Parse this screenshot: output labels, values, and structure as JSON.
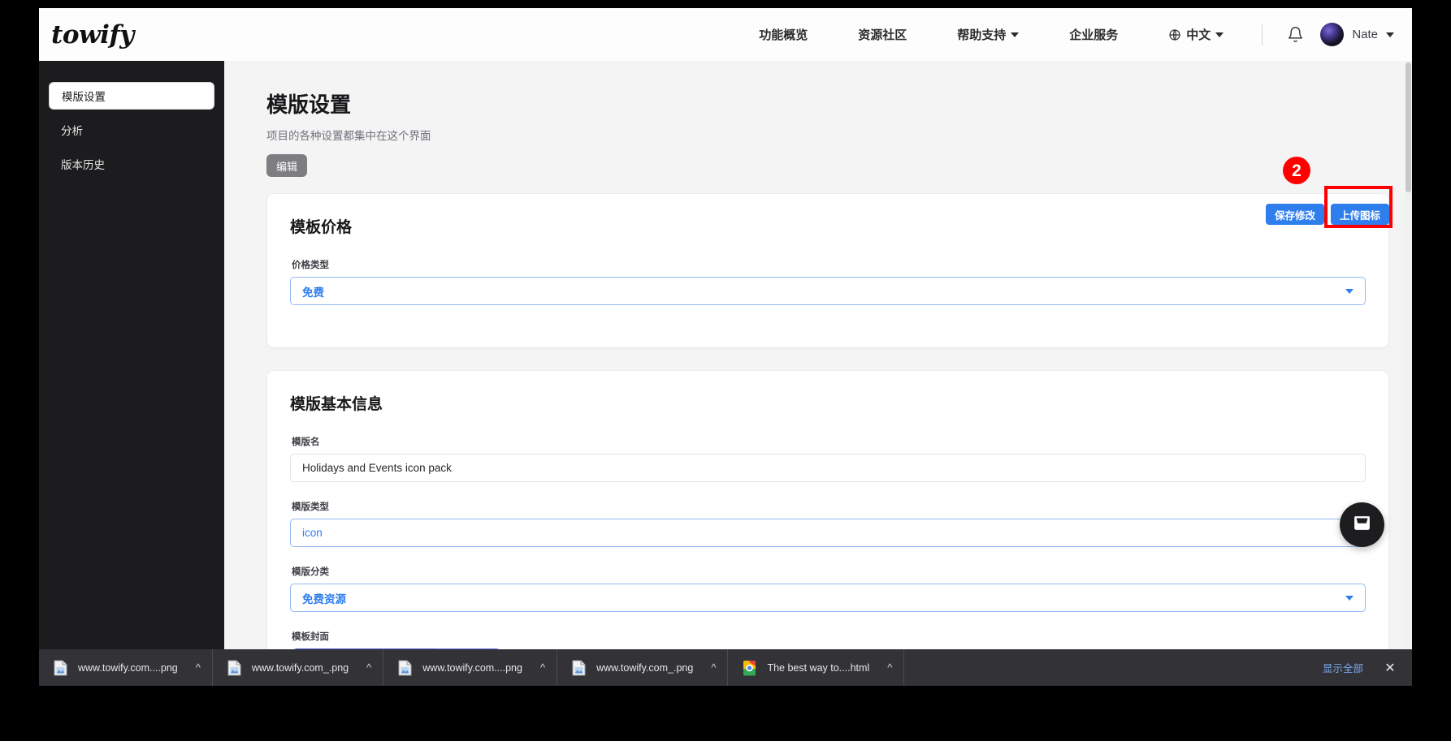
{
  "topnav": {
    "brand": "towify",
    "links": [
      {
        "label": "功能概览",
        "has_caret": false
      },
      {
        "label": "资源社区",
        "has_caret": false
      },
      {
        "label": "帮助支持",
        "has_caret": true
      },
      {
        "label": "企业服务",
        "has_caret": false
      },
      {
        "label": "中文",
        "has_caret": true,
        "icon": "globe-icon"
      }
    ],
    "bell_icon": "bell-icon",
    "avatar_icon": "avatar",
    "user_name": "Nate",
    "user_caret_icon": "chevron-down-icon"
  },
  "sidebar": {
    "items": [
      {
        "label": "模版设置",
        "active": true
      },
      {
        "label": "分析",
        "active": false
      },
      {
        "label": "版本历史",
        "active": false
      }
    ]
  },
  "page": {
    "title": "模版设置",
    "subtitle": "项目的各种设置都集中在这个界面",
    "edit_button": "编辑"
  },
  "actions": {
    "save_label": "保存修改",
    "upload_label": "上传图标"
  },
  "annotation": {
    "badge_number": "2",
    "highlight_color": "#ff0000",
    "target": "上传图标"
  },
  "price_card": {
    "title": "模板价格",
    "price_type_label": "价格类型",
    "price_type_value": "免费",
    "caret_icon": "chevron-down-icon"
  },
  "basic_card": {
    "title": "模版基本信息",
    "name_label": "模版名",
    "name_value": "Holidays and Events icon pack",
    "type_label": "模版类型",
    "type_value": "icon",
    "category_label": "模版分类",
    "category_value": "免费资源",
    "cover_label": "模板封面"
  },
  "chat": {
    "icon": "inbox-chat-icon"
  },
  "downloads": {
    "items": [
      {
        "name": "www.towify.com....png",
        "icon": "png-file-icon"
      },
      {
        "name": "www.towify.com_.png",
        "icon": "png-file-icon"
      },
      {
        "name": "www.towify.com....png",
        "icon": "png-file-icon"
      },
      {
        "name": "www.towify.com_.png",
        "icon": "png-file-icon"
      },
      {
        "name": "The best way to....html",
        "icon": "chrome-html-file-icon"
      }
    ],
    "caret_icon": "chevron-up-icon",
    "show_all": "显示全部",
    "close_icon": "close-icon"
  },
  "colors": {
    "accent_blue": "#2f7eee",
    "annotation_red": "#ff0000",
    "sidebar_bg": "#1c1c1e",
    "page_bg": "#f4f4f5"
  }
}
